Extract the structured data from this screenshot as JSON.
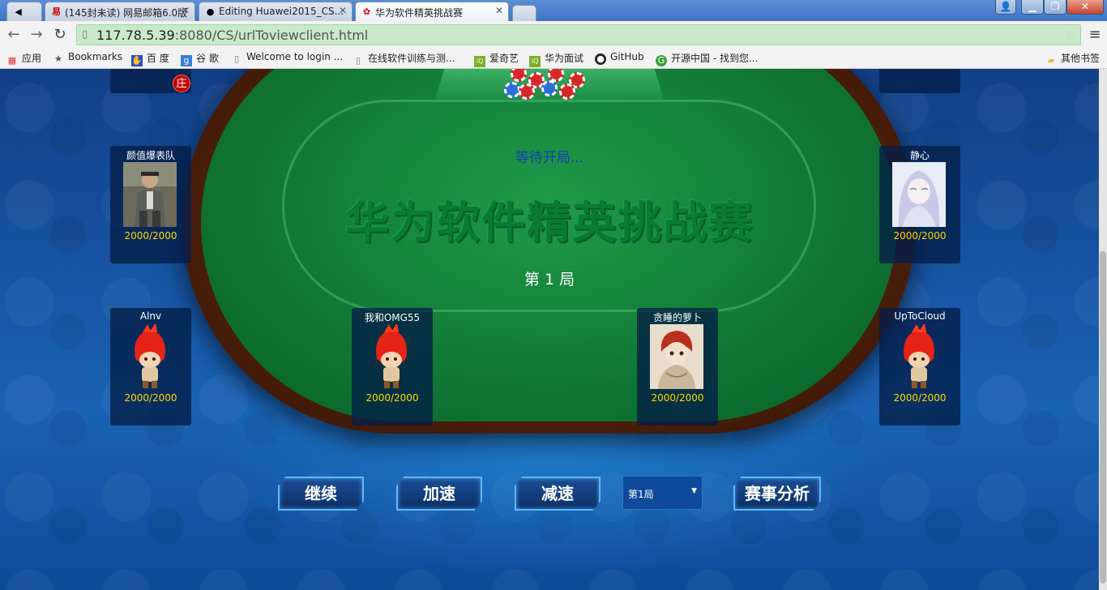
{
  "browser": {
    "tabs": [
      {
        "label": "",
        "icon": "speaker-icon",
        "active": false
      },
      {
        "label": "(145封未读) 网易邮箱6.0版",
        "icon": "netease-mail-icon",
        "active": false
      },
      {
        "label": "Editing Huawei2015_CS...",
        "icon": "github-icon",
        "active": false
      },
      {
        "label": "华为软件精英挑战赛",
        "icon": "huawei-icon",
        "active": true
      }
    ],
    "url_host": "117.78.5.39",
    "url_path": ":8080/CS/urlToviewclient.html",
    "bookmarks": [
      {
        "label": "应用",
        "icon": "apps-grid-icon"
      },
      {
        "label": "Bookmarks",
        "icon": "star-icon"
      },
      {
        "label": "百 度",
        "icon": "baidu-icon"
      },
      {
        "label": "谷 歌",
        "icon": "google-icon"
      },
      {
        "label": "Welcome to login ...",
        "icon": "page-icon"
      },
      {
        "label": "在线软件训练与测...",
        "icon": "page-icon"
      },
      {
        "label": "爱奇艺",
        "icon": "iqiyi-icon"
      },
      {
        "label": "华为面试",
        "icon": "iqiyi-icon"
      },
      {
        "label": "GitHub",
        "icon": "github-icon"
      },
      {
        "label": "开源中国 - 找到您...",
        "icon": "oschina-icon"
      }
    ],
    "other_bookmarks": "其他书签"
  },
  "game": {
    "status": "等待开局...",
    "watermark": "华为软件精英挑战赛",
    "round_label": "第 1 局",
    "dealer_badge": "庄",
    "players": [
      {
        "name": "颜值爆表队",
        "chips": "2000/2000",
        "avatar": "old-man-photo"
      },
      {
        "name": "静心",
        "chips": "2000/2000",
        "avatar": "anime-girl"
      },
      {
        "name": "Alnv",
        "chips": "2000/2000",
        "avatar": "red-hair-chibi"
      },
      {
        "name": "我和OMG55",
        "chips": "2000/2000",
        "avatar": "red-hair-chibi"
      },
      {
        "name": "贪睡的萝卜",
        "chips": "2000/2000",
        "avatar": "gaara-sketch"
      },
      {
        "name": "UpToCloud",
        "chips": "2000/2000",
        "avatar": "red-hair-chibi"
      }
    ],
    "controls": {
      "continue": "继续",
      "speed_up": "加速",
      "slow_down": "减速",
      "round_select": "第1局",
      "analysis": "赛事分析"
    },
    "colors": {
      "felt": "#178a3e",
      "rim": "#5a2a12",
      "status_text": "#1340b5",
      "chip_count": "#ffd700",
      "button_glow": "#5ab8ff"
    }
  }
}
